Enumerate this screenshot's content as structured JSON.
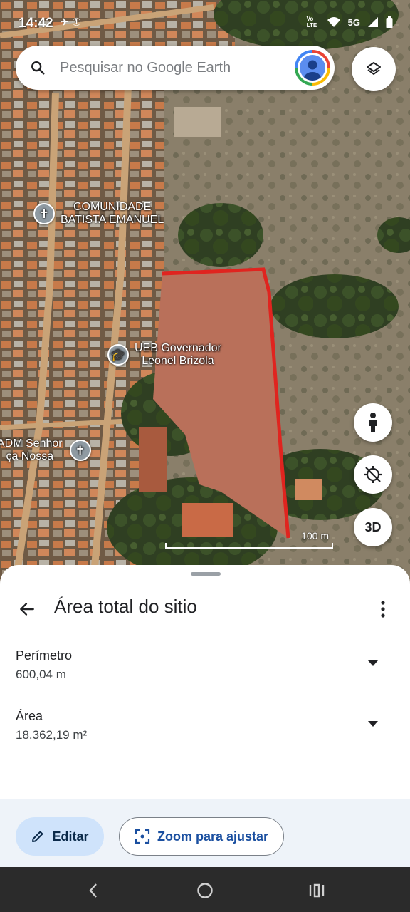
{
  "status_bar": {
    "time": "14:42",
    "network": "5G",
    "lte_label": "Vo LTE"
  },
  "search": {
    "placeholder": "Pesquisar no Google Earth"
  },
  "map": {
    "pois": [
      {
        "name": "COMUNIDADE BATISTA EMANUEL",
        "line1": "COMUNIDADE",
        "line2": "BATISTA EMANUEL",
        "icon": "cross-icon"
      },
      {
        "name": "UEB Governador Leonel Brizola",
        "line1": "UEB Governador",
        "line2": "Leonel Brizola",
        "icon": "school-icon"
      },
      {
        "name": "ADM Senhor ça Nossa",
        "line1": "ADM Senhor",
        "line2": "ça Nossa",
        "icon": "cross-icon"
      }
    ],
    "scale_label": "100 m",
    "view3d_label": "3D",
    "polygon_color": "#e0241f"
  },
  "sheet": {
    "title": "Área total do sitio",
    "measurements": [
      {
        "label": "Perímetro",
        "value": "600,04 m"
      },
      {
        "label": "Área",
        "value": "18.362,19 m²"
      }
    ]
  },
  "actions": {
    "edit_label": "Editar",
    "zoom_label": "Zoom para ajustar"
  },
  "colors": {
    "accent": "#1a4fa0",
    "edit_bg": "#cfe3fb",
    "actions_bg": "#eef3f9"
  }
}
